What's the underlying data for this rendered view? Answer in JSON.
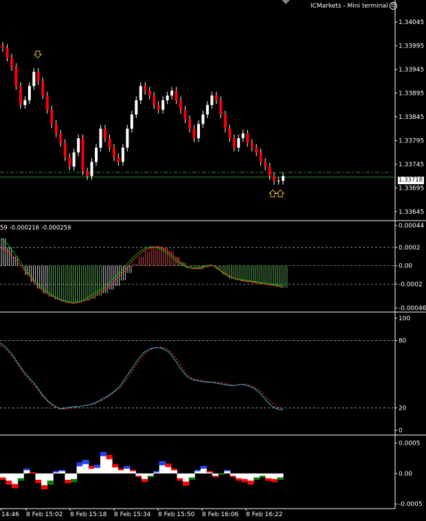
{
  "window": {
    "title": "ICMarkets - Mini terminal",
    "smiley_icon": "smiley-face-icon"
  },
  "price_tag": "1.33718",
  "macd_label": "59 -0.000216 -0.000259",
  "colors": {
    "bull": "#ffffff",
    "bear": "#ff0000",
    "grid": "#c8c8c8",
    "hline": "#2e8b2e",
    "arrow": "#f0c040",
    "main_line": "#00c000",
    "signal_line": "#ff3030",
    "stoch_main": "#40b0d0",
    "stoch_signal": "#ff3030",
    "blue": "#2040ff",
    "green": "#008000"
  },
  "chart_data": [
    {
      "type": "candlestick",
      "name": "price",
      "yticks": [
        "1.34045",
        "1.33995",
        "1.33945",
        "1.33895",
        "1.33845",
        "1.33795",
        "1.33745",
        "1.33695",
        "1.33645"
      ],
      "ylim": [
        1.33645,
        1.34045
      ],
      "last_price": 1.33718,
      "horizontal_lines": [
        1.33728,
        1.33718
      ],
      "up_arrows_at": [
        1.33685,
        1.33685
      ],
      "down_arrow_at": 1.33975,
      "closes": [
        1.3399,
        1.3397,
        1.3395,
        1.3391,
        1.3387,
        1.3388,
        1.3391,
        1.3394,
        1.3392,
        1.3389,
        1.3386,
        1.3383,
        1.3381,
        1.3379,
        1.3376,
        1.3374,
        1.3377,
        1.338,
        1.3373,
        1.3372,
        1.3375,
        1.3378,
        1.3382,
        1.338,
        1.3378,
        1.3376,
        1.3375,
        1.3378,
        1.3382,
        1.3385,
        1.3388,
        1.3391,
        1.339,
        1.3389,
        1.3387,
        1.3386,
        1.3388,
        1.3389,
        1.339,
        1.3388,
        1.3386,
        1.3384,
        1.3382,
        1.338,
        1.3383,
        1.3385,
        1.3387,
        1.3389,
        1.3388,
        1.3385,
        1.3382,
        1.338,
        1.3378,
        1.338,
        1.3381,
        1.3379,
        1.3378,
        1.3377,
        1.3375,
        1.3374,
        1.3372,
        1.3371,
        1.3371,
        1.3372
      ]
    },
    {
      "type": "histogram_line",
      "name": "MACD",
      "yticks": [
        "0.00044",
        "0.0002",
        "0.00",
        "-0.0002",
        "-0.00046"
      ],
      "ylim": [
        -0.00046,
        0.00044
      ],
      "histogram": [
        0.0003,
        0.0002,
        0.0001,
        0.0,
        -0.0001,
        -0.00018,
        -0.00025,
        -0.0003,
        -0.00034,
        -0.00037,
        -0.00039,
        -0.0004,
        -0.0004,
        -0.00039,
        -0.00038,
        -0.00036,
        -0.00033,
        -0.0003,
        -0.00026,
        -0.00022,
        -0.00016,
        -8e-05,
        2e-05,
        0.0001,
        0.00016,
        0.0002,
        0.00021,
        0.0002,
        0.00016,
        0.0001,
        4e-05,
        -2e-05,
        -4e-05,
        -4e-05,
        -2e-05,
        0.0,
        -4e-05,
        -0.0001,
        -0.00014,
        -0.00016,
        -0.00017,
        -0.00018,
        -0.00019,
        -0.0002,
        -0.00021,
        -0.00022,
        -0.00023,
        -0.00024
      ],
      "main_line": [
        0.0003,
        0.00024,
        0.00015,
        6e-05,
        -4e-05,
        -0.00012,
        -0.0002,
        -0.00025,
        -0.0003,
        -0.00034,
        -0.00037,
        -0.00039,
        -0.0004,
        -0.00039,
        -0.00036,
        -0.00032,
        -0.00028,
        -0.00024,
        -0.00018,
        -0.00012,
        -6e-05,
        2e-05,
        9e-05,
        0.00015,
        0.00019,
        0.00021,
        0.0002,
        0.00017,
        0.00012,
        6e-05,
        1e-05,
        -2e-05,
        -3e-05,
        -2e-05,
        0.0,
        1e-05,
        -3e-05,
        -8e-05,
        -0.00012,
        -0.00014,
        -0.00015,
        -0.00016,
        -0.00017,
        -0.00018,
        -0.00019,
        -0.0002,
        -0.00021,
        -0.00022
      ],
      "signal_line": [
        0.0002,
        0.00016,
        0.0001,
        2e-05,
        -6e-05,
        -0.00014,
        -0.00022,
        -0.00028,
        -0.00032,
        -0.00035,
        -0.00038,
        -0.0004,
        -0.00041,
        -0.0004,
        -0.00038,
        -0.00035,
        -0.00031,
        -0.00027,
        -0.00022,
        -0.00016,
        -9e-05,
        -2e-05,
        6e-05,
        0.00012,
        0.00017,
        0.0002,
        0.00021,
        0.00019,
        0.00015,
        9e-05,
        3e-05,
        -1e-05,
        -3e-05,
        -3e-05,
        -1e-05,
        1e-05,
        -2e-05,
        -7e-05,
        -0.00011,
        -0.00014,
        -0.00016,
        -0.00017,
        -0.00018,
        -0.00019,
        -0.0002,
        -0.00021,
        -0.00022,
        -0.00024
      ]
    },
    {
      "type": "line",
      "name": "Stochastic",
      "yticks": [
        "100",
        "80",
        "20",
        "0"
      ],
      "ylim": [
        0,
        100
      ],
      "levels": [
        80,
        20
      ],
      "main_line": [
        78,
        74,
        68,
        60,
        52,
        46,
        40,
        32,
        26,
        22,
        19,
        20,
        21,
        21,
        22,
        23,
        25,
        28,
        31,
        35,
        40,
        48,
        56,
        64,
        70,
        73,
        74,
        73,
        70,
        63,
        55,
        48,
        45,
        44,
        43,
        43,
        42,
        41,
        40,
        40,
        41,
        40,
        38,
        34,
        28,
        22,
        19,
        18
      ],
      "signal_line": [
        76,
        72,
        66,
        58,
        50,
        44,
        38,
        31,
        25,
        21,
        19,
        19,
        20,
        21,
        22,
        23,
        24,
        27,
        30,
        34,
        38,
        45,
        53,
        61,
        68,
        72,
        74,
        74,
        72,
        66,
        58,
        50,
        46,
        45,
        44,
        43,
        43,
        42,
        41,
        40,
        41,
        41,
        39,
        36,
        31,
        25,
        21,
        19
      ]
    },
    {
      "type": "histogram",
      "name": "Oscillator",
      "yticks": [
        "0.0005",
        "0.00",
        "-0.0005"
      ],
      "ylim": [
        -0.00052,
        0.00055
      ],
      "values": [
        -0.0001,
        -0.00018,
        -0.00024,
        -0.00012,
        8e-05,
        2e-05,
        -0.00016,
        -0.00026,
        -0.00018,
        4e-05,
        6e-05,
        -0.00016,
        -0.00014,
        0.00018,
        0.00022,
        0.00012,
        0.00014,
        0.00035,
        0.0003,
        0.00015,
        8e-05,
        0.00012,
        6e-05,
        -6e-05,
        -0.00014,
        -6e-05,
        4e-05,
        0.0002,
        0.00016,
        8e-05,
        -0.00012,
        -0.0002,
        -0.0001,
        6e-05,
        0.00012,
        4e-05,
        -6e-05,
        -2e-05,
        6e-05,
        -6e-05,
        -0.00012,
        -0.00014,
        -0.00018,
        -0.0001,
        -6e-05,
        -0.00012,
        -0.00014,
        -0.0001
      ]
    }
  ],
  "xaxis": {
    "labels": [
      "14:46",
      "8 Feb 15:02",
      "8 Feb 15:18",
      "8 Feb 15:34",
      "8 Feb 15:50",
      "8 Feb 16:06",
      "8 Feb 16:22"
    ]
  }
}
